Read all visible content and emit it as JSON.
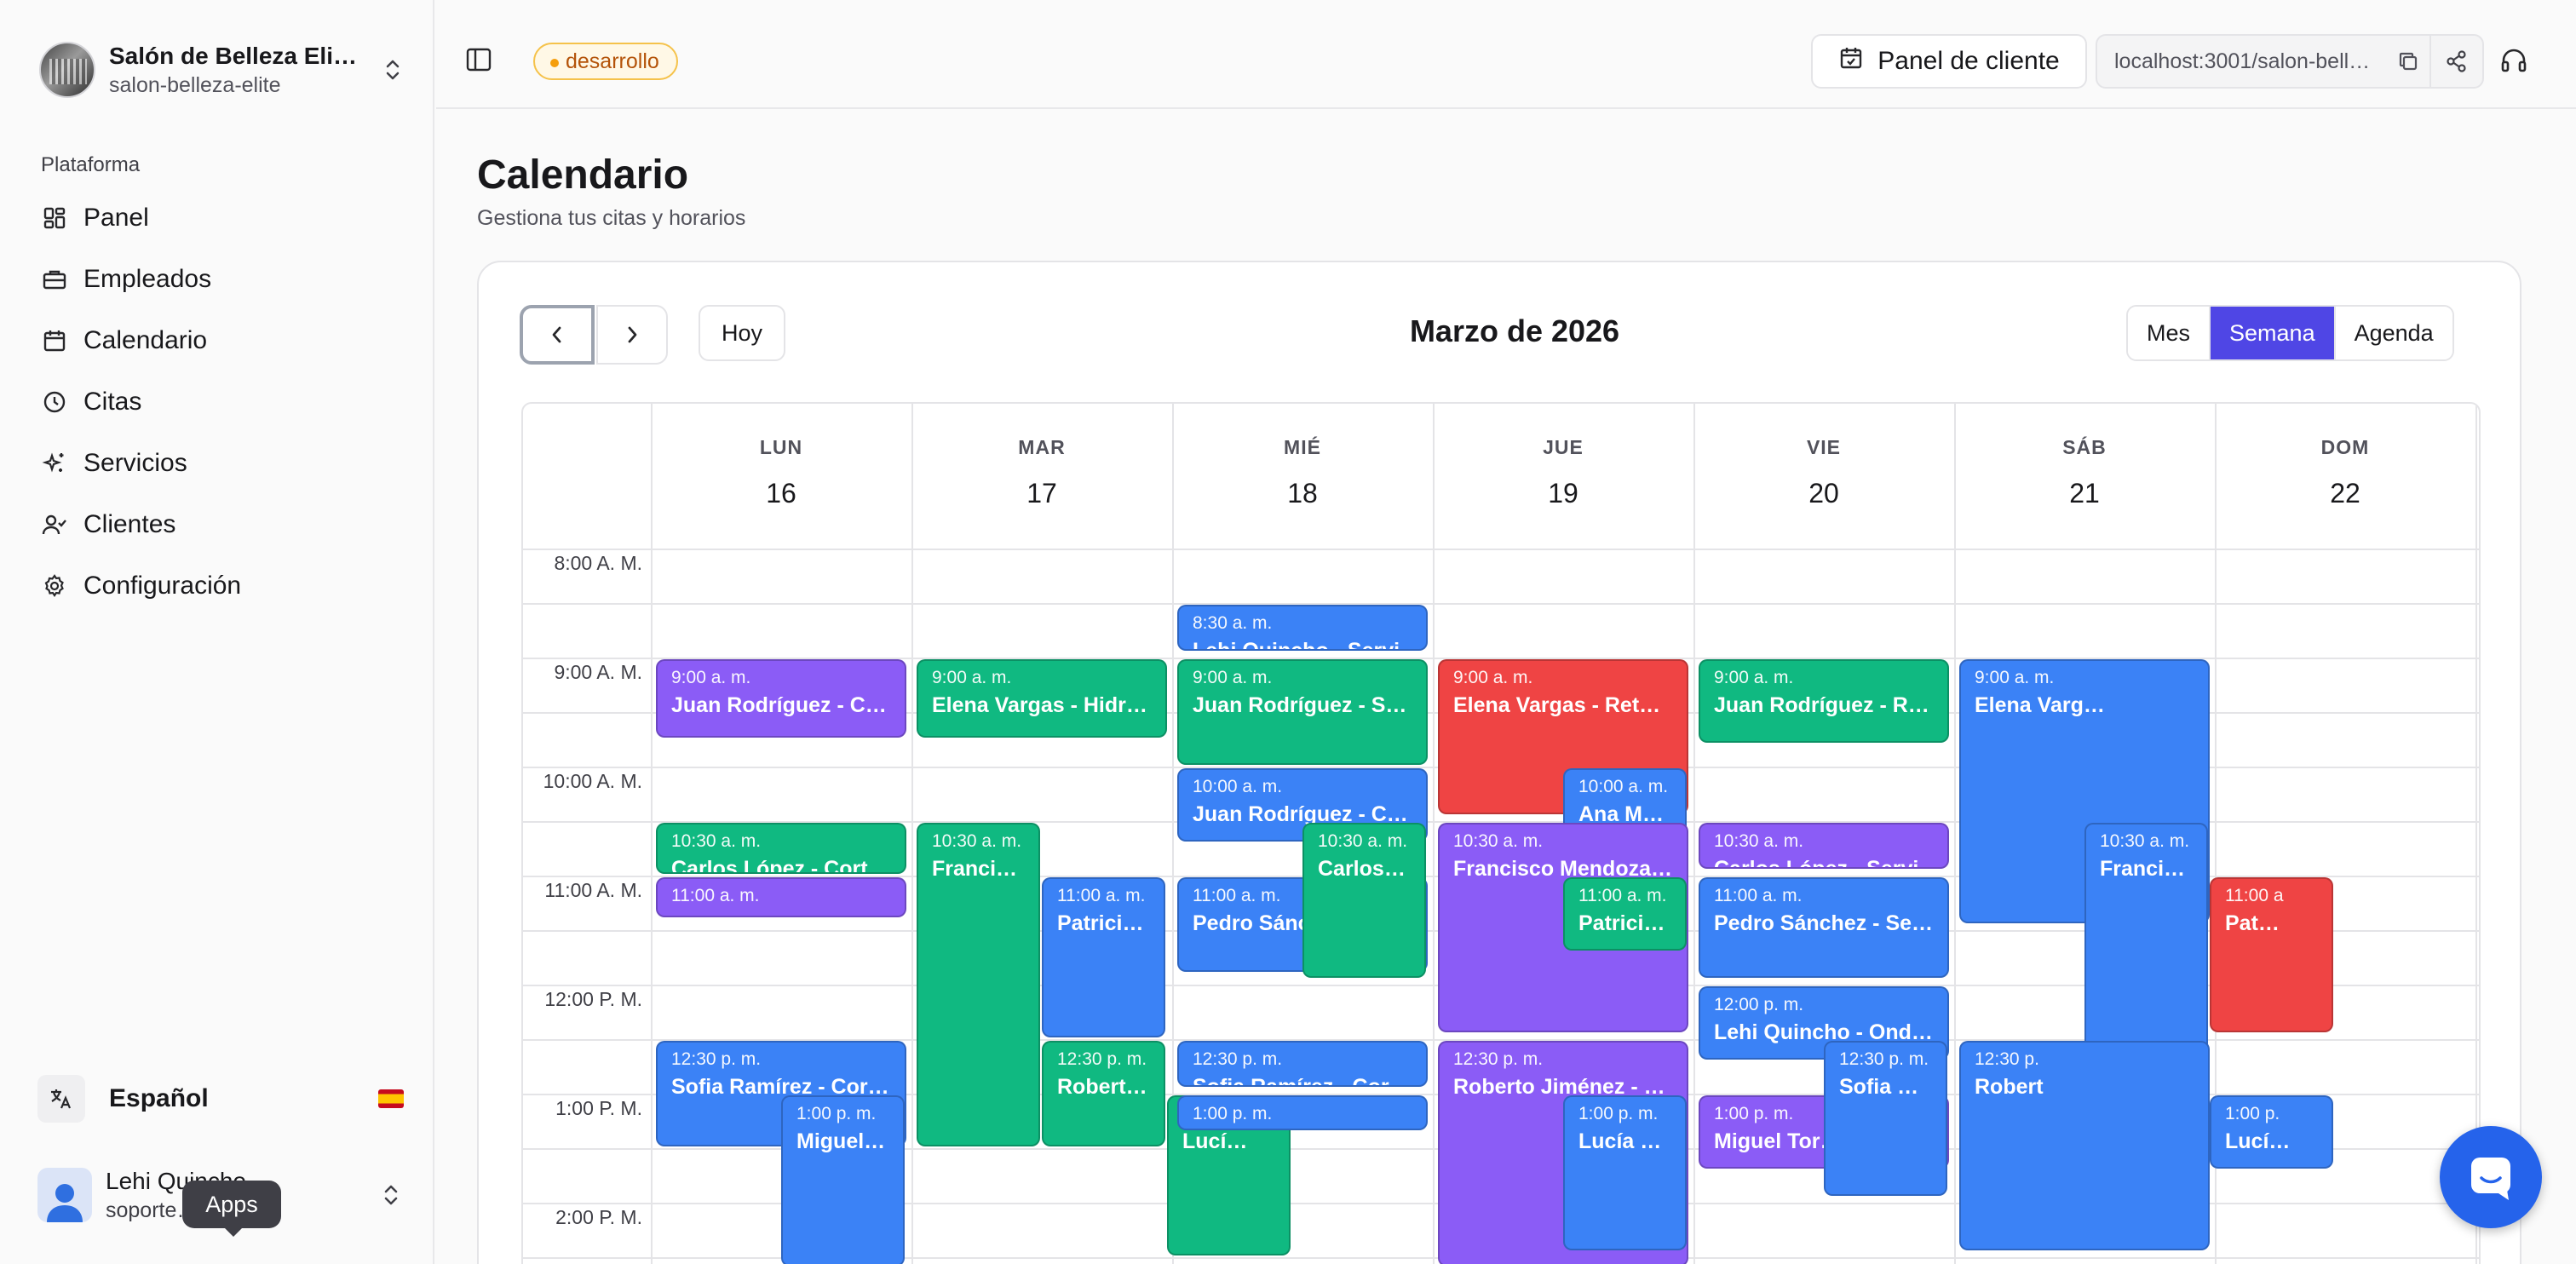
{
  "org": {
    "name": "Salón de Belleza Eli…",
    "slug": "salon-belleza-elite"
  },
  "sidebar": {
    "section_label": "Plataforma",
    "items": [
      {
        "label": "Panel",
        "icon": "dashboard-icon"
      },
      {
        "label": "Empleados",
        "icon": "briefcase-icon"
      },
      {
        "label": "Calendario",
        "icon": "calendar-icon"
      },
      {
        "label": "Citas",
        "icon": "clock-icon"
      },
      {
        "label": "Servicios",
        "icon": "sparkles-icon"
      },
      {
        "label": "Clientes",
        "icon": "user-check-icon"
      },
      {
        "label": "Configuración",
        "icon": "gear-icon"
      }
    ],
    "language": "Español",
    "user": {
      "name": "Lehi Quincho",
      "email": "soporte…da.pe"
    },
    "tooltip": "Apps"
  },
  "topbar": {
    "env_badge": "desarrollo",
    "client_panel": "Panel de cliente",
    "url": "localhost:3001/salon-bell…"
  },
  "page": {
    "title": "Calendario",
    "subtitle": "Gestiona tus citas y horarios"
  },
  "calendar": {
    "today_label": "Hoy",
    "month_title": "Marzo de 2026",
    "views": [
      "Mes",
      "Semana",
      "Agenda"
    ],
    "active_view": "Semana",
    "days": [
      {
        "name": "LUN",
        "num": "16"
      },
      {
        "name": "MAR",
        "num": "17"
      },
      {
        "name": "MIÉ",
        "num": "18"
      },
      {
        "name": "JUE",
        "num": "19"
      },
      {
        "name": "VIE",
        "num": "20"
      },
      {
        "name": "SÁB",
        "num": "21"
      },
      {
        "name": "DOM",
        "num": "22"
      }
    ],
    "times": [
      "8:00 A. M.",
      "9:00 A. M.",
      "10:00 A. M.",
      "11:00 A. M.",
      "12:00 P. M.",
      "1:00 P. M.",
      "2:00 P. M."
    ],
    "events": [
      {
        "day": 0,
        "start": 9.0,
        "end": 9.75,
        "lane": 0,
        "lanes": 1,
        "color": "purple",
        "time": "9:00 a. m.",
        "title": "Juan Rodríguez - C…"
      },
      {
        "day": 0,
        "start": 10.5,
        "end": 11.0,
        "lane": 0,
        "lanes": 1,
        "color": "green",
        "time": "10:30 a. m.",
        "title": "Carlos López - Cort"
      },
      {
        "day": 0,
        "start": 11.0,
        "end": 11.4,
        "lane": 0,
        "lanes": 1,
        "color": "purple",
        "time": "11:00 a. m.",
        "title": ""
      },
      {
        "day": 0,
        "start": 12.5,
        "end": 13.5,
        "lane": 0,
        "lanes": 1,
        "color": "blue",
        "time": "12:30 p. m.",
        "title": "Sofia Ramírez - Cor…"
      },
      {
        "day": 0,
        "start": 13.0,
        "end": 14.6,
        "lane": 1,
        "lanes": 2,
        "color": "blue",
        "time": "1:00 p. m.",
        "title": "Miguel …"
      },
      {
        "day": 1,
        "start": 9.0,
        "end": 9.75,
        "lane": 0,
        "lanes": 1,
        "color": "green",
        "time": "9:00 a. m.",
        "title": "Elena Vargas - Hidr…"
      },
      {
        "day": 1,
        "start": 10.5,
        "end": 13.5,
        "lane": 0,
        "lanes": 2,
        "color": "green",
        "time": "10:30 a. m.",
        "title": "Francisco M…"
      },
      {
        "day": 1,
        "start": 11.0,
        "end": 12.5,
        "lane": 1,
        "lanes": 2,
        "color": "blue",
        "time": "11:00 a. m.",
        "title": "Patricia Rey…"
      },
      {
        "day": 1,
        "start": 12.5,
        "end": 13.5,
        "lane": 1,
        "lanes": 2,
        "color": "green",
        "time": "12:30 p. m.",
        "title": "Roberto Ji…"
      },
      {
        "day": 1,
        "start": 13.0,
        "end": 14.5,
        "lane": 2,
        "lanes": 3,
        "color": "green",
        "time": "1:00 p.",
        "title": "Lucí…"
      },
      {
        "day": 2,
        "start": 8.5,
        "end": 8.95,
        "lane": 0,
        "lanes": 1,
        "color": "blue",
        "time": "8:30 a. m.",
        "title": "Lehi Quincho - Servi"
      },
      {
        "day": 2,
        "start": 9.0,
        "end": 10.0,
        "lane": 0,
        "lanes": 1,
        "color": "green",
        "time": "9:00 a. m.",
        "title": "Juan Rodríguez - Se…"
      },
      {
        "day": 2,
        "start": 10.0,
        "end": 10.7,
        "lane": 0,
        "lanes": 1,
        "color": "blue",
        "time": "10:00 a. m.",
        "title": "Juan Rodríguez - C…"
      },
      {
        "day": 2,
        "start": 11.0,
        "end": 11.9,
        "lane": 0,
        "lanes": 1,
        "color": "blue",
        "time": "11:00 a. m.",
        "title": "Pedro Sánc…"
      },
      {
        "day": 2,
        "start": 10.5,
        "end": 11.95,
        "lane": 1,
        "lanes": 2,
        "color": "green",
        "time": "10:30 a. m.",
        "title": "Carlos L…"
      },
      {
        "day": 2,
        "start": 12.5,
        "end": 12.95,
        "lane": 0,
        "lanes": 1,
        "color": "blue",
        "time": "12:30 p. m.",
        "title": "Sofia Ramírez - Cor"
      },
      {
        "day": 2,
        "start": 13.0,
        "end": 13.35,
        "lane": 0,
        "lanes": 1,
        "color": "blue",
        "time": "1:00 p. m.",
        "title": ""
      },
      {
        "day": 3,
        "start": 9.0,
        "end": 10.45,
        "lane": 0,
        "lanes": 1,
        "color": "red",
        "time": "9:00 a. m.",
        "title": "Elena Vargas - Reto…"
      },
      {
        "day": 3,
        "start": 10.0,
        "end": 10.7,
        "lane": 1,
        "lanes": 2,
        "color": "blue",
        "time": "10:00 a. m.",
        "title": "Ana Ma…"
      },
      {
        "day": 3,
        "start": 10.5,
        "end": 12.45,
        "lane": 0,
        "lanes": 1,
        "color": "purple",
        "time": "10:30 a. m.",
        "title": "Francisco Mendoza …"
      },
      {
        "day": 3,
        "start": 11.0,
        "end": 11.7,
        "lane": 1,
        "lanes": 2,
        "color": "green",
        "time": "11:00 a. m.",
        "title": "Patricia…"
      },
      {
        "day": 3,
        "start": 12.5,
        "end": 14.6,
        "lane": 0,
        "lanes": 1,
        "color": "purple",
        "time": "12:30 p. m.",
        "title": "Roberto Jiménez - …"
      },
      {
        "day": 3,
        "start": 13.0,
        "end": 14.45,
        "lane": 1,
        "lanes": 2,
        "color": "blue",
        "time": "1:00 p. m.",
        "title": "Lucía H…"
      },
      {
        "day": 4,
        "start": 9.0,
        "end": 9.8,
        "lane": 0,
        "lanes": 1,
        "color": "green",
        "time": "9:00 a. m.",
        "title": "Juan Rodríguez - R…"
      },
      {
        "day": 4,
        "start": 10.5,
        "end": 10.95,
        "lane": 0,
        "lanes": 1,
        "color": "purple",
        "time": "10:30 a. m.",
        "title": "Carlos López - Servi"
      },
      {
        "day": 4,
        "start": 11.0,
        "end": 11.95,
        "lane": 0,
        "lanes": 1,
        "color": "blue",
        "time": "11:00 a. m.",
        "title": "Pedro Sánchez - Ser…"
      },
      {
        "day": 4,
        "start": 12.0,
        "end": 12.7,
        "lane": 0,
        "lanes": 1,
        "color": "blue",
        "time": "12:00 p. m.",
        "title": "Lehi Quincho - Ond…"
      },
      {
        "day": 4,
        "start": 13.0,
        "end": 13.7,
        "lane": 0,
        "lanes": 1,
        "color": "purple",
        "time": "1:00 p. m.",
        "title": "Miguel Tor…"
      },
      {
        "day": 4,
        "start": 12.5,
        "end": 13.95,
        "lane": 1,
        "lanes": 2,
        "color": "blue",
        "time": "12:30 p. m.",
        "title": "Sofia R…"
      },
      {
        "day": 5,
        "start": 9.0,
        "end": 11.45,
        "lane": 0,
        "lanes": 1,
        "color": "blue",
        "time": "9:00 a. m.",
        "title": "Elena Varg…"
      },
      {
        "day": 5,
        "start": 10.5,
        "end": 13.45,
        "lane": 1,
        "lanes": 2,
        "color": "blue",
        "time": "10:30 a. m.",
        "title": "Francisco M…"
      },
      {
        "day": 5,
        "start": 11.0,
        "end": 12.45,
        "lane": 2,
        "lanes": 3,
        "color": "red",
        "time": "11:00 a",
        "title": "Pat…"
      },
      {
        "day": 5,
        "start": 12.5,
        "end": 14.45,
        "lane": 0,
        "lanes": 1,
        "color": "blue",
        "time": "12:30 p.",
        "title": "Robert"
      },
      {
        "day": 5,
        "start": 13.0,
        "end": 13.7,
        "lane": 2,
        "lanes": 3,
        "color": "blue",
        "time": "1:00 p.",
        "title": "Lucí…"
      }
    ]
  },
  "colors": {
    "accent": "#4f46e5",
    "blue": "#3b82f6",
    "green": "#10b981",
    "purple": "#8b5cf6",
    "red": "#ef4444"
  }
}
